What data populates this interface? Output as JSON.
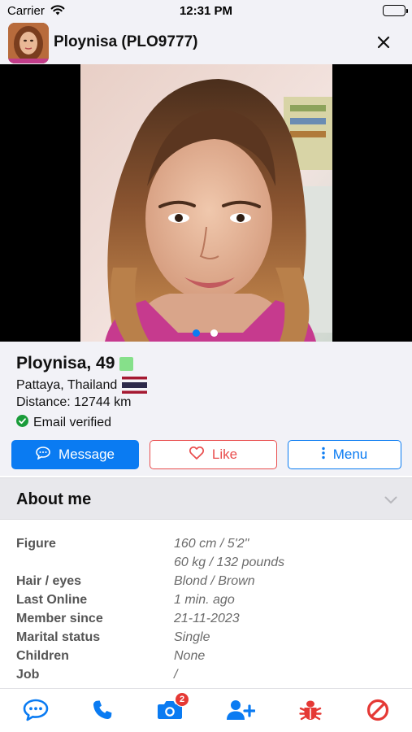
{
  "status_bar": {
    "carrier": "Carrier",
    "time": "12:31 PM"
  },
  "header": {
    "title": "Ploynisa (PLO9777)"
  },
  "profile": {
    "name_age": "Ploynisa, 49",
    "location": "Pattaya, Thailand",
    "distance": "Distance: 12744 km",
    "email_status": "Email verified",
    "photo_count": 2,
    "current_photo": 1
  },
  "actions": {
    "message": "Message",
    "like": "Like",
    "menu": "Menu"
  },
  "about": {
    "title": "About me"
  },
  "details": [
    {
      "key": "Figure",
      "value": "160 cm / 5'2\""
    },
    {
      "key": "",
      "value": "60 kg / 132 pounds"
    },
    {
      "key": "Hair / eyes",
      "value": "Blond / Brown"
    },
    {
      "key": "Last Online",
      "value": "1 min. ago"
    },
    {
      "key": "Member since",
      "value": "21-11-2023"
    },
    {
      "key": "Marital status",
      "value": "Single"
    },
    {
      "key": "Children",
      "value": "None"
    },
    {
      "key": "Job",
      "value": "/"
    }
  ],
  "tabbar": {
    "camera_badge": "2"
  },
  "colors": {
    "accent_blue": "#0a7bf2",
    "like_red": "#e94d4d",
    "online_green": "#86e08a",
    "verified_green": "#1a9c3a",
    "bug_red": "#e53935"
  },
  "icons": [
    "wifi-icon",
    "battery-icon",
    "close-icon",
    "chat-bubble-icon",
    "heart-icon",
    "more-vertical-icon",
    "check-circle-icon",
    "thailand-flag-icon",
    "chevron-down-icon",
    "chat-icon",
    "phone-icon",
    "camera-icon",
    "add-user-icon",
    "bug-icon",
    "block-icon"
  ]
}
